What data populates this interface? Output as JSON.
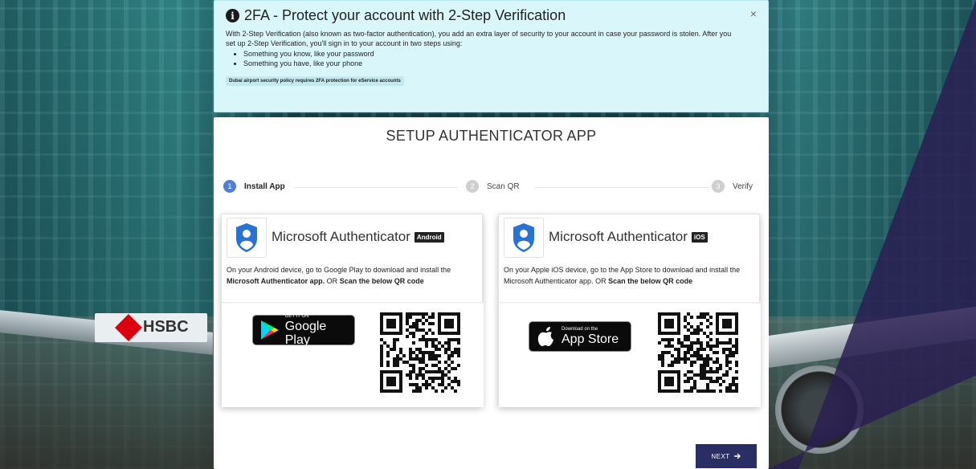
{
  "alert": {
    "title": "2FA - Protect your account with 2-Step Verification",
    "close": "×",
    "body": "With 2-Step Verification (also known as two-factor authentication), you add an extra layer of security to your account in case your password is stolen. After you set up 2-Step Verification, you'll sign in to your account in two steps using:",
    "bullets": [
      "Something you know, like your password",
      "Something you have, like your phone"
    ],
    "badge": "Dubai airport security policy requires 2FA protection for eService accounts"
  },
  "panel": {
    "title": "SETUP AUTHENTICATOR APP"
  },
  "stepper": {
    "steps": [
      {
        "number": "1",
        "label": "Install App",
        "state": "active"
      },
      {
        "number": "2",
        "label": "Scan QR",
        "state": "inactive"
      },
      {
        "number": "3",
        "label": "Verify",
        "state": "inactive"
      }
    ]
  },
  "cards": {
    "android": {
      "app_name": "Microsoft Authenticator",
      "os_badge": "Android",
      "text_prefix": "On your Android device, go to Google Play to download and install the ",
      "text_bold1": "Microsoft Authenticator app.",
      "text_mid": " OR ",
      "text_bold2": "Scan the below QR code",
      "store_small": "GET IT ON",
      "store_big": "Google Play"
    },
    "ios": {
      "app_name": "Microsoft Authenticator",
      "os_badge": "iOS",
      "text_prefix": "On your Apple iOS device, go to the App Store to download and install the Microsoft Authenticator app.",
      "text_mid": " OR ",
      "text_bold2": "Scan the below QR code",
      "store_small": "Download on the",
      "store_big": "App Store"
    }
  },
  "buttons": {
    "next": "NEXT",
    "next_icon": "arrow-right-icon"
  },
  "background": {
    "sign_text": "HSBC"
  },
  "colors": {
    "alert_bg": "#d9f7fb",
    "step_active": "#4f7fd8",
    "next_button": "#2b2e63"
  }
}
